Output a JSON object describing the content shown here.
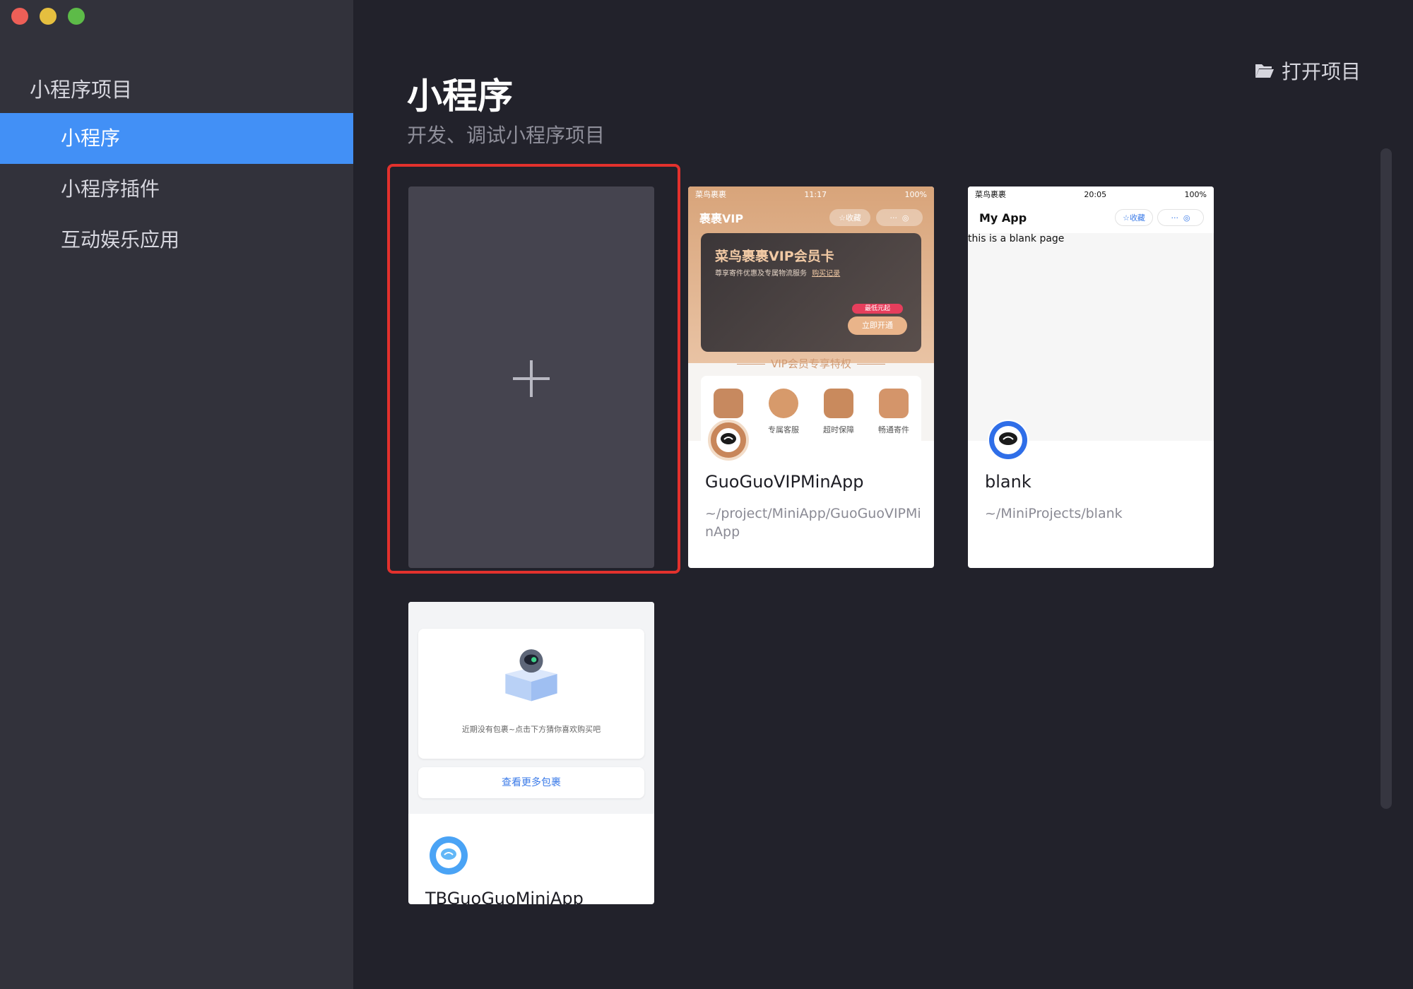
{
  "sidebar": {
    "group_title": "小程序项目",
    "items": [
      {
        "label": "小程序"
      },
      {
        "label": "小程序插件"
      },
      {
        "label": "互动娱乐应用"
      }
    ]
  },
  "header": {
    "title": "小程序",
    "subtitle": "开发、调试小程序项目",
    "open_project": "打开项目"
  },
  "new_project": {
    "plus_icon": "plus-icon"
  },
  "projects": [
    {
      "name": "GuoGuoVIPMinApp",
      "path": "~/project/MiniApp/GuoGuoVIPMinApp",
      "preview": {
        "status_left": "菜鸟裹裹",
        "status_time": "11:17",
        "status_battery": "100%",
        "nav_title": "裹裹VIP",
        "fav": "收藏",
        "card_title": "菜鸟裹裹VIP会员卡",
        "card_sub": "尊享寄件优惠及专属物流服务",
        "card_link": "购买记录",
        "badge": "最低元起",
        "cta": "立即开通",
        "section": "VIP会员专享特权",
        "perks": [
          "",
          "专属客服",
          "超时保障",
          "畅通寄件"
        ]
      }
    },
    {
      "name": "blank",
      "path": "~/MiniProjects/blank",
      "preview": {
        "status_left": "菜鸟裹裹",
        "status_time": "20:05",
        "status_battery": "100%",
        "nav_title": "My App",
        "fav": "收藏",
        "body": "this is a blank page"
      }
    },
    {
      "name": "TBGuoGuoMiniApp",
      "preview": {
        "empty_text": "近期没有包裹~点击下方猜你喜欢购买吧",
        "button": "查看更多包裹"
      }
    }
  ],
  "colors": {
    "accent": "#4290f6",
    "highlight": "#e3312d",
    "vip_gold": "#d9a57a"
  }
}
